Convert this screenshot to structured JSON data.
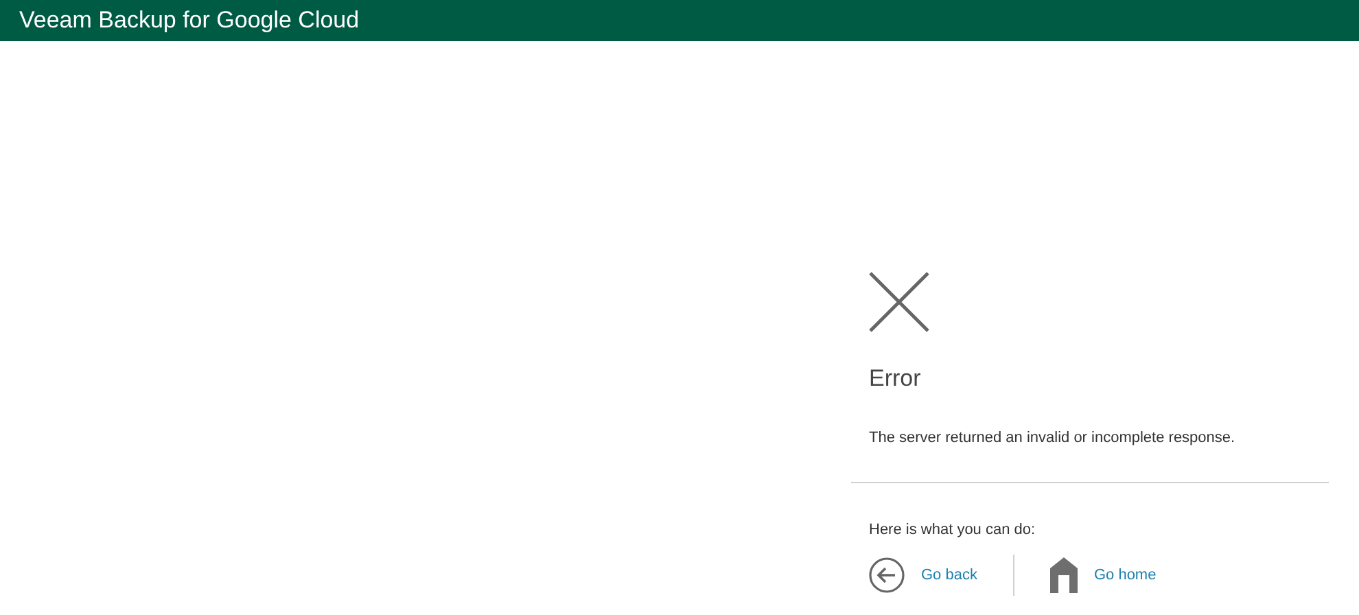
{
  "header": {
    "title": "Veeam Backup for Google Cloud"
  },
  "error": {
    "title": "Error",
    "message": "The server returned an invalid or incomplete response.",
    "hint": "Here is what you can do:"
  },
  "actions": [
    {
      "kind": "back",
      "label": "Go back"
    },
    {
      "kind": "home",
      "label": "Go home"
    }
  ]
}
